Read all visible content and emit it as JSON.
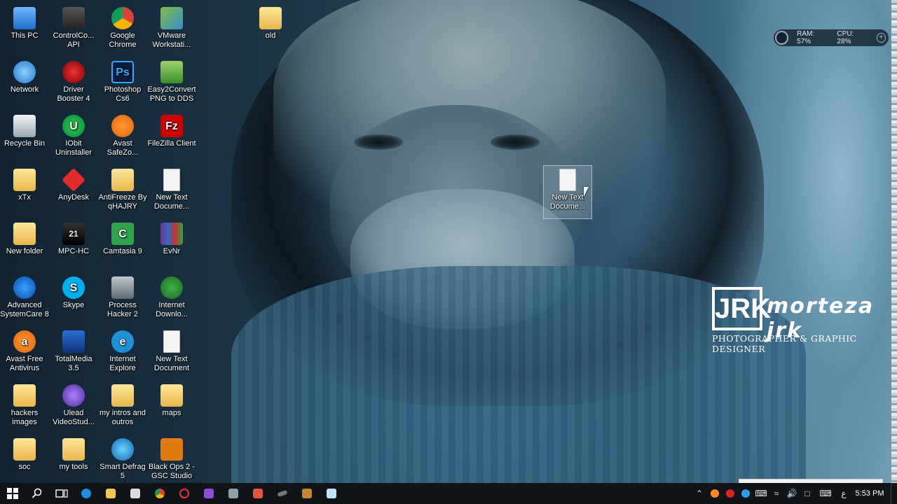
{
  "desktop": {
    "icons": [
      {
        "label": "This PC",
        "icon": "this-pc-icon"
      },
      {
        "label": "ControlCo... API",
        "icon": "control-api-icon"
      },
      {
        "label": "Google Chrome",
        "icon": "chrome-icon"
      },
      {
        "label": "VMware Workstati...",
        "icon": "vmware-icon"
      },
      {
        "label": "old",
        "icon": "folder-icon"
      },
      {
        "label": "Network",
        "icon": "network-icon"
      },
      {
        "label": "Driver Booster 4",
        "icon": "driver-booster-icon"
      },
      {
        "label": "Photoshop Cs6",
        "icon": "photoshop-icon"
      },
      {
        "label": "Easy2Convert PNG to DDS",
        "icon": "easy2convert-icon"
      },
      {
        "label": "Recycle Bin",
        "icon": "recycle-bin-icon"
      },
      {
        "label": "IObit Uninstaller",
        "icon": "iobit-icon"
      },
      {
        "label": "Avast SafeZo...",
        "icon": "avast-safezone-icon"
      },
      {
        "label": "FileZilla Client",
        "icon": "filezilla-icon"
      },
      {
        "label": "xTx",
        "icon": "folder-icon"
      },
      {
        "label": "AnyDesk",
        "icon": "anydesk-icon"
      },
      {
        "label": "AntiFreeze By qHAJRY",
        "icon": "folder-icon"
      },
      {
        "label": "New Text Docume...",
        "icon": "text-document-icon"
      },
      {
        "label": "New folder",
        "icon": "folder-icon"
      },
      {
        "label": "MPC-HC",
        "icon": "mpc-hc-icon"
      },
      {
        "label": "Camtasia 9",
        "icon": "camtasia-icon"
      },
      {
        "label": "EvNr",
        "icon": "winrar-icon"
      },
      {
        "label": "Advanced SystemCare 8",
        "icon": "advanced-systemcare-icon"
      },
      {
        "label": "Skype",
        "icon": "skype-icon"
      },
      {
        "label": "Process Hacker 2",
        "icon": "process-hacker-icon"
      },
      {
        "label": "Internet Downlo...",
        "icon": "idm-icon"
      },
      {
        "label": "Avast Free Antivirus",
        "icon": "avast-icon"
      },
      {
        "label": "TotalMedia 3.5",
        "icon": "totalmedia-icon"
      },
      {
        "label": "Internet Explore",
        "icon": "internet-explorer-icon"
      },
      {
        "label": "New Text Document",
        "icon": "text-document-icon"
      },
      {
        "label": "hackers images",
        "icon": "folder-icon"
      },
      {
        "label": "Ulead VideoStud...",
        "icon": "ulead-icon"
      },
      {
        "label": "my intros and outros",
        "icon": "folder-icon"
      },
      {
        "label": "maps",
        "icon": "folder-icon"
      },
      {
        "label": "soc",
        "icon": "folder-icon"
      },
      {
        "label": "my tools",
        "icon": "folder-icon"
      },
      {
        "label": "Smart Defrag 5",
        "icon": "smart-defrag-icon"
      },
      {
        "label": "Black Ops 2 - GSC Studio",
        "icon": "black-ops-icon"
      },
      {
        "label": "New Text Docume...",
        "icon": "text-document-icon",
        "selected": true
      }
    ],
    "glyphs": {
      "ps": "Ps",
      "fz": "Fz",
      "mpc": "21",
      "skype": "S",
      "ie": "e",
      "avast": "a",
      "camtasia": "C",
      "iobit": "U"
    }
  },
  "gadget": {
    "ram": "RAM: 57%",
    "cpu": "CPU: 28%",
    "plus": "+"
  },
  "watermark": {
    "mark": "JRK",
    "name": "morteza jrk",
    "tagline": "PHOTOGRAPHER & GRAPHIC DESIGNER"
  },
  "taskbar": {
    "apps": [
      "start-icon",
      "search-icon",
      "task-view-icon",
      "edge-icon",
      "file-explorer-icon",
      "store-icon",
      "chrome-icon",
      "media-icon",
      "visual-studio-icon",
      "process-hacker-icon",
      "camtasia-icon",
      "pen-icon",
      "game-icon",
      "notepad-icon"
    ],
    "tray": {
      "ime": "ع",
      "time": "5:53 PM"
    }
  },
  "colors": {
    "taskbar": "#101418",
    "selection": "#96aabe",
    "text": "#ffffff"
  }
}
